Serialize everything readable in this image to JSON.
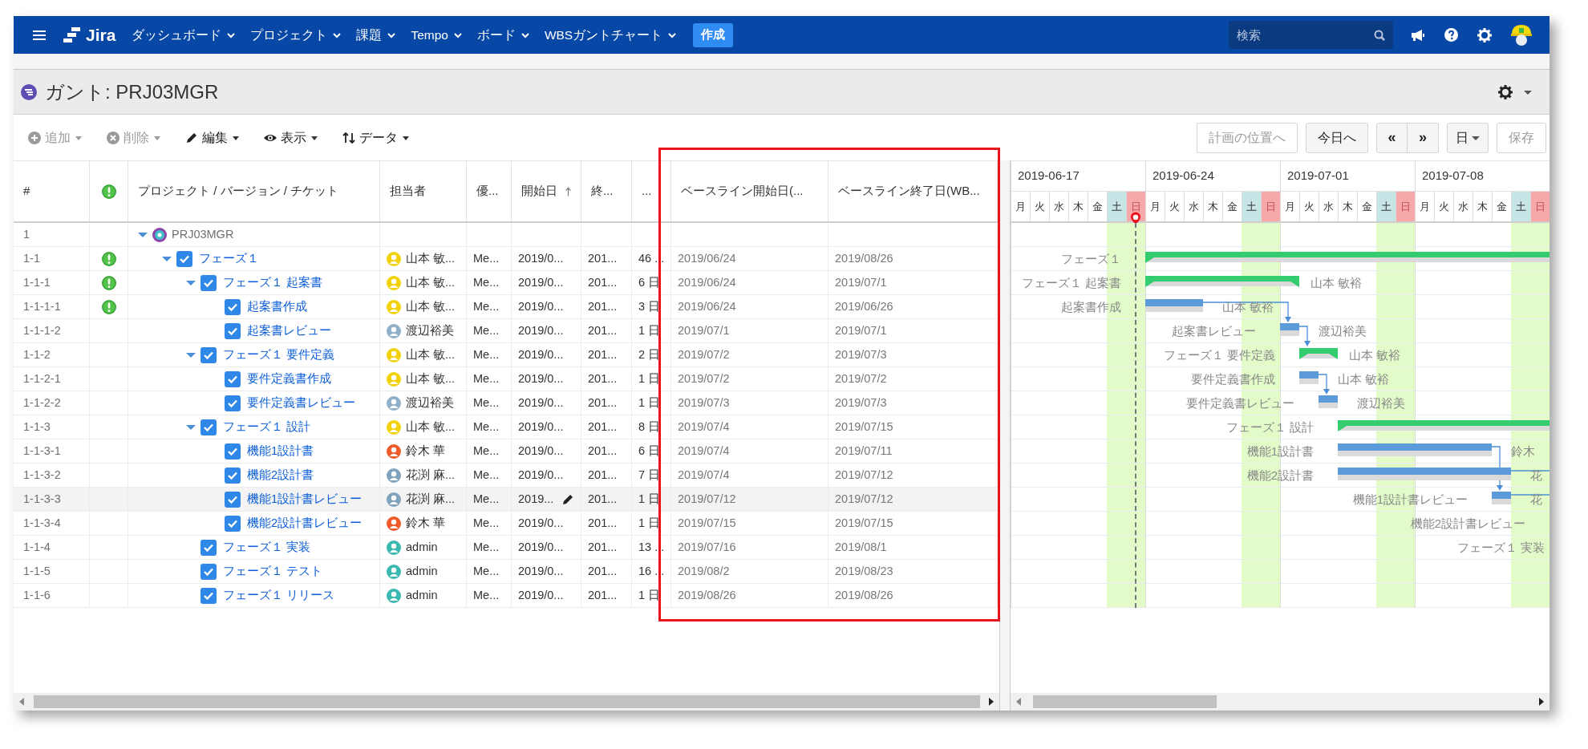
{
  "nav": {
    "logo": "Jira",
    "menu_items": [
      {
        "label": "ダッシュボード"
      },
      {
        "label": "プロジェクト"
      },
      {
        "label": "課題"
      },
      {
        "label": "Tempo"
      },
      {
        "label": "ボード"
      },
      {
        "label": "WBSガントチャート"
      }
    ],
    "create_button": "作成",
    "search": {
      "placeholder": "検索"
    }
  },
  "page_title": "ガント: PRJ03MGR",
  "toolbar": {
    "left": [
      {
        "label": "追加",
        "kind": "plus",
        "disabled": true
      },
      {
        "label": "削除",
        "kind": "remove",
        "disabled": true
      },
      {
        "label": "編集",
        "kind": "pencil",
        "disabled": false
      },
      {
        "label": "表示",
        "kind": "eye",
        "disabled": false
      },
      {
        "label": "データ",
        "kind": "updown",
        "disabled": false
      }
    ],
    "right": [
      {
        "kind": "button",
        "label": "計画の位置へ",
        "disabled": true
      },
      {
        "kind": "button",
        "label": "今日へ",
        "disabled": false
      },
      {
        "kind": "pair",
        "labels": [
          "«",
          "»"
        ]
      },
      {
        "kind": "dropdown",
        "label": "日"
      },
      {
        "kind": "button",
        "label": "保存",
        "disabled": true
      }
    ]
  },
  "table": {
    "columns": [
      {
        "kind": "text",
        "label": "#"
      },
      {
        "kind": "flag"
      },
      {
        "kind": "text",
        "label": "プロジェクト / バージョン / チケット"
      },
      {
        "kind": "text",
        "label": "担当者"
      },
      {
        "kind": "text",
        "label": "優..."
      },
      {
        "kind": "sorted",
        "label": "開始日"
      },
      {
        "kind": "text",
        "label": "終..."
      },
      {
        "kind": "text",
        "label": "..."
      },
      {
        "kind": "text",
        "label": "ベースライン開始日(..."
      },
      {
        "kind": "text",
        "label": "ベースライン終了日(WB..."
      }
    ],
    "rows": [
      {
        "kind": "project",
        "num": "1",
        "name": "PRJ03MGR",
        "expanded": true,
        "selected": false,
        "children": [
          {
            "kind": "issue",
            "num": "1-1",
            "flagged": true,
            "name": "フェーズ１",
            "assignee": "山本 敏...",
            "avatar": {
              "color": "#f2d20c"
            },
            "priority": "Me...",
            "start": "2019/0...",
            "end": "201...",
            "duration": "46 ...",
            "baseline_start": "2019/06/24",
            "baseline_end": "2019/08/26",
            "expanded": true,
            "selected": false,
            "children": [
              {
                "kind": "issue",
                "num": "1-1-1",
                "flagged": true,
                "name": "フェーズ１ 起案書",
                "assignee": "山本 敏...",
                "avatar": {
                  "color": "#f2d20c"
                },
                "priority": "Me...",
                "start": "2019/0...",
                "end": "201...",
                "duration": "6 日",
                "baseline_start": "2019/06/24",
                "baseline_end": "2019/07/1",
                "expanded": true,
                "selected": false,
                "children": [
                  {
                    "kind": "issue",
                    "num": "1-1-1-1",
                    "flagged": true,
                    "name": "起案書作成",
                    "assignee": "山本 敏...",
                    "avatar": {
                      "color": "#f2d20c"
                    },
                    "priority": "Me...",
                    "start": "2019/0...",
                    "end": "201...",
                    "duration": "3 日",
                    "baseline_start": "2019/06/24",
                    "baseline_end": "2019/06/26",
                    "selected": false
                  },
                  {
                    "kind": "issue",
                    "num": "1-1-1-2",
                    "flagged": false,
                    "name": "起案書レビュー",
                    "assignee": "渡辺裕美",
                    "avatar": {
                      "color": "#8fb0c8"
                    },
                    "priority": "Me...",
                    "start": "2019/0...",
                    "end": "201...",
                    "duration": "1 日",
                    "baseline_start": "2019/07/1",
                    "baseline_end": "2019/07/1",
                    "selected": false
                  }
                ]
              },
              {
                "kind": "issue",
                "num": "1-1-2",
                "flagged": false,
                "name": "フェーズ１ 要件定義",
                "assignee": "山本 敏...",
                "avatar": {
                  "color": "#f2d20c"
                },
                "priority": "Me...",
                "start": "2019/0...",
                "end": "201...",
                "duration": "2 日",
                "baseline_start": "2019/07/2",
                "baseline_end": "2019/07/3",
                "expanded": true,
                "selected": false,
                "children": [
                  {
                    "kind": "issue",
                    "num": "1-1-2-1",
                    "flagged": false,
                    "name": "要件定義書作成",
                    "assignee": "山本 敏...",
                    "avatar": {
                      "color": "#f2d20c"
                    },
                    "priority": "Me...",
                    "start": "2019/0...",
                    "end": "201...",
                    "duration": "1 日",
                    "baseline_start": "2019/07/2",
                    "baseline_end": "2019/07/2",
                    "selected": false
                  },
                  {
                    "kind": "issue",
                    "num": "1-1-2-2",
                    "flagged": false,
                    "name": "要件定義書レビュー",
                    "assignee": "渡辺裕美",
                    "avatar": {
                      "color": "#8fb0c8"
                    },
                    "priority": "Me...",
                    "start": "2019/0...",
                    "end": "201...",
                    "duration": "1 日",
                    "baseline_start": "2019/07/3",
                    "baseline_end": "2019/07/3",
                    "selected": false
                  }
                ]
              },
              {
                "kind": "issue",
                "num": "1-1-3",
                "flagged": false,
                "name": "フェーズ１ 設計",
                "assignee": "山本 敏...",
                "avatar": {
                  "color": "#f2d20c"
                },
                "priority": "Me...",
                "start": "2019/0...",
                "end": "201...",
                "duration": "8 日",
                "baseline_start": "2019/07/4",
                "baseline_end": "2019/07/15",
                "expanded": true,
                "selected": false,
                "children": [
                  {
                    "kind": "issue",
                    "num": "1-1-3-1",
                    "flagged": false,
                    "name": "機能1設計書",
                    "assignee": "鈴木 華",
                    "avatar": {
                      "color": "#f05a28"
                    },
                    "priority": "Me...",
                    "start": "2019/0...",
                    "end": "201...",
                    "duration": "6 日",
                    "baseline_start": "2019/07/4",
                    "baseline_end": "2019/07/11",
                    "selected": false
                  },
                  {
                    "kind": "issue",
                    "num": "1-1-3-2",
                    "flagged": false,
                    "name": "機能2設計書",
                    "assignee": "花渕 麻...",
                    "avatar": {
                      "color": "#7fa2bd"
                    },
                    "priority": "Me...",
                    "start": "2019/0...",
                    "end": "201...",
                    "duration": "7 日",
                    "baseline_start": "2019/07/4",
                    "baseline_end": "2019/07/12",
                    "selected": false
                  },
                  {
                    "kind": "issue",
                    "num": "1-1-3-3",
                    "flagged": false,
                    "name": "機能1設計書レビュー",
                    "assignee": "花渕 麻...",
                    "avatar": {
                      "color": "#7fa2bd"
                    },
                    "priority": "Me...",
                    "start": "2019...",
                    "end": "201...",
                    "duration": "1 日",
                    "baseline_start": "2019/07/12",
                    "baseline_end": "2019/07/12",
                    "selected": true
                  },
                  {
                    "kind": "issue",
                    "num": "1-1-3-4",
                    "flagged": false,
                    "name": "機能2設計書レビュー",
                    "assignee": "鈴木 華",
                    "avatar": {
                      "color": "#f05a28"
                    },
                    "priority": "Me...",
                    "start": "2019/0...",
                    "end": "201...",
                    "duration": "1 日",
                    "baseline_start": "2019/07/15",
                    "baseline_end": "2019/07/15",
                    "selected": false
                  }
                ]
              },
              {
                "kind": "issue",
                "num": "1-1-4",
                "flagged": false,
                "name": "フェーズ１ 実装",
                "assignee": "admin",
                "avatar": {
                  "color": "#3bb8b0"
                },
                "priority": "Me...",
                "start": "2019/0...",
                "end": "201...",
                "duration": "13 ...",
                "baseline_start": "2019/07/16",
                "baseline_end": "2019/08/1",
                "selected": false
              },
              {
                "kind": "issue",
                "num": "1-1-5",
                "flagged": false,
                "name": "フェーズ１ テスト",
                "assignee": "admin",
                "avatar": {
                  "color": "#3bb8b0"
                },
                "priority": "Me...",
                "start": "2019/0...",
                "end": "201...",
                "duration": "16 ...",
                "baseline_start": "2019/08/2",
                "baseline_end": "2019/08/23",
                "selected": false
              },
              {
                "kind": "issue",
                "num": "1-1-6",
                "flagged": false,
                "name": "フェーズ１ リリース",
                "assignee": "admin",
                "avatar": {
                  "color": "#3bb8b0"
                },
                "priority": "Me...",
                "start": "2019/0...",
                "end": "201...",
                "duration": "1 日",
                "baseline_start": "2019/08/26",
                "baseline_end": "2019/08/26",
                "selected": false
              }
            ]
          }
        ]
      }
    ]
  },
  "gantt": {
    "weeks": [
      {
        "label": "2019-06-17",
        "days": [
          {
            "label": "月",
            "kind": "weekday"
          },
          {
            "label": "火",
            "kind": "weekday"
          },
          {
            "label": "水",
            "kind": "weekday"
          },
          {
            "label": "木",
            "kind": "weekday"
          },
          {
            "label": "金",
            "kind": "weekday"
          },
          {
            "label": "土",
            "kind": "saturday"
          },
          {
            "label": "日",
            "kind": "sunday",
            "today": true
          }
        ]
      },
      {
        "label": "2019-06-24",
        "days": [
          {
            "label": "月",
            "kind": "weekday"
          },
          {
            "label": "火",
            "kind": "weekday"
          },
          {
            "label": "水",
            "kind": "weekday"
          },
          {
            "label": "木",
            "kind": "weekday"
          },
          {
            "label": "金",
            "kind": "weekday"
          },
          {
            "label": "土",
            "kind": "saturday"
          },
          {
            "label": "日",
            "kind": "sunday"
          }
        ]
      },
      {
        "label": "2019-07-01",
        "days": [
          {
            "label": "月",
            "kind": "weekday"
          },
          {
            "label": "火",
            "kind": "weekday"
          },
          {
            "label": "水",
            "kind": "weekday"
          },
          {
            "label": "木",
            "kind": "weekday"
          },
          {
            "label": "金",
            "kind": "weekday"
          },
          {
            "label": "土",
            "kind": "saturday"
          },
          {
            "label": "日",
            "kind": "sunday"
          }
        ]
      },
      {
        "label": "2019-07-08",
        "days": [
          {
            "label": "月",
            "kind": "weekday"
          },
          {
            "label": "火",
            "kind": "weekday"
          },
          {
            "label": "水",
            "kind": "weekday"
          },
          {
            "label": "木",
            "kind": "weekday"
          },
          {
            "label": "金",
            "kind": "weekday"
          },
          {
            "label": "土",
            "kind": "saturday"
          },
          {
            "label": "日",
            "kind": "sunday"
          }
        ]
      }
    ],
    "rows": [
      {
        "kind": "empty"
      },
      {
        "kind": "summary",
        "label": "フェーズ１"
      },
      {
        "kind": "summary",
        "label": "フェーズ１ 起案書",
        "assignee": "山本 敏裕"
      },
      {
        "kind": "task",
        "label": "起案書作成",
        "assignee": "山本 敏裕",
        "link": {
          "kind": "next"
        }
      },
      {
        "kind": "task",
        "label": "起案書レビュー",
        "assignee": "渡辺裕美",
        "link": {
          "kind": "next"
        }
      },
      {
        "kind": "summary",
        "label": "フェーズ１ 要件定義",
        "assignee": "山本 敏裕"
      },
      {
        "kind": "task",
        "label": "要件定義書作成",
        "assignee": "山本 敏裕",
        "link": {
          "kind": "next"
        }
      },
      {
        "kind": "task",
        "label": "要件定義書レビュー",
        "assignee": "渡辺裕美"
      },
      {
        "kind": "summary",
        "label": "フェーズ１ 設計"
      },
      {
        "kind": "task",
        "label": "機能1設計書",
        "assignee": "鈴木",
        "link": {
          "kind": "second_next"
        }
      },
      {
        "kind": "task",
        "label": "機能2設計書",
        "assignee": "花",
        "link": {
          "kind": "off_right"
        }
      },
      {
        "kind": "task",
        "label": "機能1設計書レビュー",
        "assignee": "花",
        "link": {
          "kind": "off_right"
        }
      },
      {
        "kind": "label_only",
        "label": "機能2設計書レビュー"
      },
      {
        "kind": "label_only",
        "label": "フェーズ１ 実装"
      },
      {
        "kind": "empty"
      },
      {
        "kind": "empty"
      }
    ]
  }
}
